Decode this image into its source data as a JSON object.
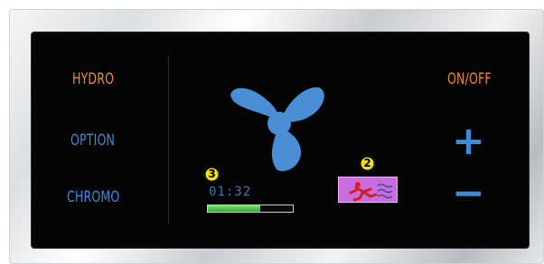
{
  "labels": {
    "hydro": "HYDRO",
    "option": "OPTION",
    "chromo": "CHROMO",
    "onoff": "ON/OFF"
  },
  "controls": {
    "plus": "+",
    "minus": "−"
  },
  "timer": {
    "value": "01:32",
    "progress_fraction": 0.62
  },
  "badges": {
    "timer_badge": "3",
    "mode_badge": "2"
  },
  "icons": {
    "fan": "fan-icon",
    "mode": "chromotherapy-mode-icon"
  },
  "colors": {
    "orange_label": "#f08a24",
    "blue_label": "#3a8bdc",
    "fan_blue": "#4a8fd6",
    "badge_yellow": "#f4e10a",
    "mode_icon_bg": "#c86ce0",
    "mode_icon_figure": "#d32020"
  }
}
